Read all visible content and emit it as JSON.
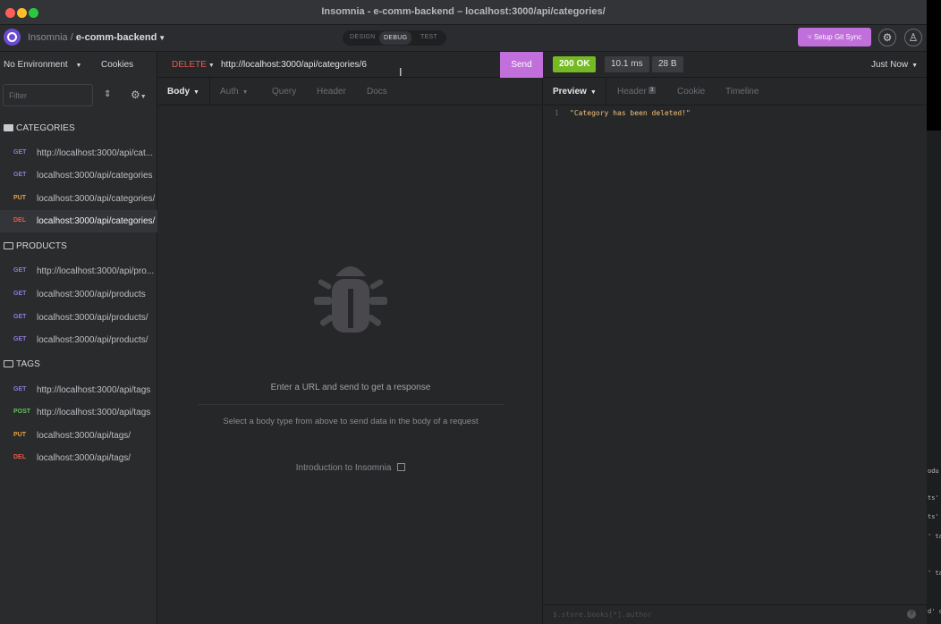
{
  "titlebar": {
    "title": "Insomnia - e-comm-backend – localhost:3000/api/categories/"
  },
  "topbar": {
    "app_name": "Insomnia",
    "separator": " / ",
    "workspace": "e-comm-backend",
    "modes": [
      "DESIGN",
      "DEBUG",
      "TEST"
    ],
    "active_mode": "DEBUG",
    "git_sync_label": "Setup Git Sync",
    "accent_color": "#c16fdb"
  },
  "sidebar": {
    "environment": "No Environment",
    "cookies_label": "Cookies",
    "filter_placeholder": "Filter",
    "folders": [
      {
        "name": "CATEGORIES",
        "requests": [
          {
            "method": "GET",
            "url": "http://localhost:3000/api/cat..."
          },
          {
            "method": "GET",
            "url": "localhost:3000/api/categories"
          },
          {
            "method": "PUT",
            "url": "localhost:3000/api/categories/"
          },
          {
            "method": "DEL",
            "url": "localhost:3000/api/categories/"
          }
        ]
      },
      {
        "name": "PRODUCTS",
        "requests": [
          {
            "method": "GET",
            "url": "http://localhost:3000/api/pro..."
          },
          {
            "method": "GET",
            "url": "localhost:3000/api/products"
          },
          {
            "method": "GET",
            "url": "localhost:3000/api/products/"
          },
          {
            "method": "GET",
            "url": "localhost:3000/api/products/"
          }
        ]
      },
      {
        "name": "TAGS",
        "requests": [
          {
            "method": "GET",
            "url": "http://localhost:3000/api/tags"
          },
          {
            "method": "POST",
            "url": "http://localhost:3000/api/tags"
          },
          {
            "method": "PUT",
            "url": "localhost:3000/api/tags/"
          },
          {
            "method": "DEL",
            "url": "localhost:3000/api/tags/"
          }
        ]
      }
    ]
  },
  "request": {
    "method": "DELETE",
    "url": "http://localhost:3000/api/categories/6",
    "send_label": "Send",
    "tabs": [
      "Body",
      "Auth",
      "Query",
      "Header",
      "Docs"
    ],
    "empty_title": "Enter a URL and send to get a response",
    "empty_subtitle": "Select a body type from above to send data in the body of a request",
    "intro_link": "Introduction to Insomnia"
  },
  "response": {
    "status": "200 OK",
    "time": "10.1 ms",
    "size": "28 B",
    "timestamp": "Just Now",
    "tabs": [
      "Preview",
      "Header",
      "Cookie",
      "Timeline"
    ],
    "header_count": "3",
    "body_line_number": "1",
    "body_text": "\"Category has been deleted!\"",
    "filter_expression": "$.store.books[*].author",
    "help_icon": "?",
    "status_color": "#75ba24"
  }
}
